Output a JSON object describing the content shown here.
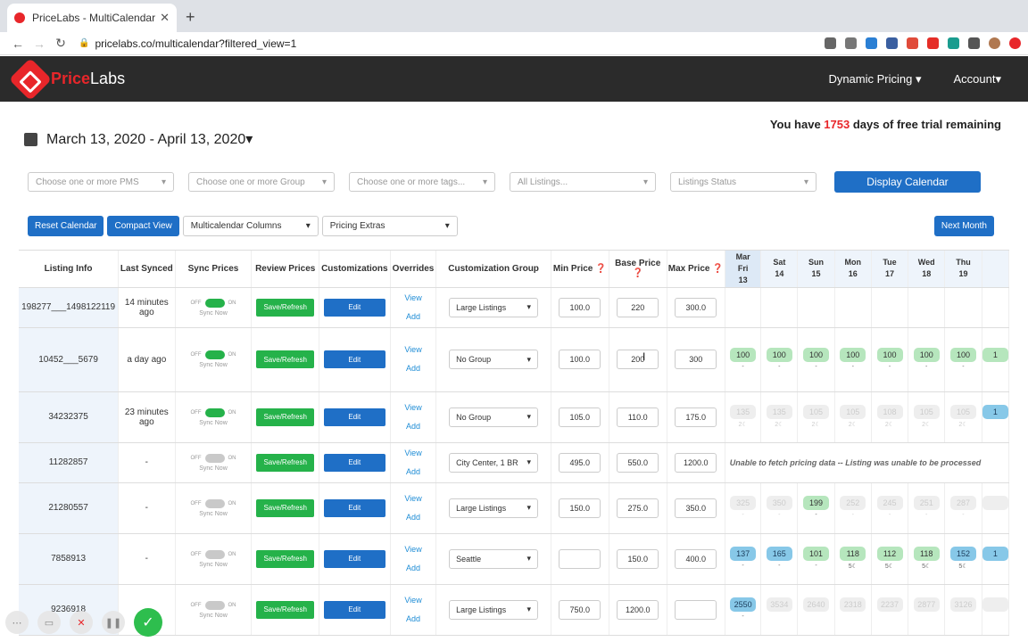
{
  "browser": {
    "tab_title": "PriceLabs - MultiCalendar",
    "tab_close": "✕",
    "new_tab": "+",
    "url": "pricelabs.co/multicalendar?filtered_view=1"
  },
  "app": {
    "logo_a": "Price",
    "logo_b": "Labs",
    "nav": [
      {
        "label": "Dynamic Pricing ▾"
      },
      {
        "label": "Account▾"
      }
    ]
  },
  "trial": {
    "pre": "You have ",
    "days": "1753",
    "post": " days of free trial remaining"
  },
  "date_range": "March 13, 2020 - April 13, 2020▾",
  "filters": {
    "pms": "Choose one or more PMS",
    "group": "Choose one or more Group",
    "tags": "Choose one or more tags...",
    "listings": "All Listings...",
    "status": "Listings Status",
    "display_btn": "Display Calendar"
  },
  "controls": {
    "reset": "Reset Calendar",
    "compact": "Compact View",
    "columns": "Multicalendar Columns",
    "extras": "Pricing Extras",
    "next_month": "Next Month"
  },
  "headers": {
    "listing": "Listing Info",
    "synced": "Last Synced",
    "sync": "Sync Prices",
    "review": "Review Prices",
    "custom": "Customizations",
    "overrides": "Overrides",
    "group": "Customization Group",
    "min": "Min Price ❓",
    "base": "Base Price ❓",
    "max": "Max Price ❓"
  },
  "days": [
    {
      "m": "Mar",
      "d": "Fri",
      "n": "13"
    },
    {
      "m": "",
      "d": "Sat",
      "n": "14"
    },
    {
      "m": "",
      "d": "Sun",
      "n": "15"
    },
    {
      "m": "",
      "d": "Mon",
      "n": "16"
    },
    {
      "m": "",
      "d": "Tue",
      "n": "17"
    },
    {
      "m": "",
      "d": "Wed",
      "n": "18"
    },
    {
      "m": "",
      "d": "Thu",
      "n": "19"
    },
    {
      "m": "",
      "d": "",
      "n": ""
    }
  ],
  "labels": {
    "sync_now": "Sync Now",
    "off": "OFF",
    "on": "ON",
    "save": "Save/Refresh",
    "edit": "Edit",
    "view": "View",
    "add": "Add",
    "caret": "▾"
  },
  "rows": [
    {
      "id": "198277___1498122119",
      "synced": "14 minutes ago",
      "sync_on": true,
      "group": "Large Listings",
      "min": "100.0",
      "base": "220",
      "max": "300.0",
      "cells": []
    },
    {
      "id": "10452___5679",
      "synced": "a day ago",
      "sync_on": true,
      "group": "No Group",
      "min": "100.0",
      "base": "200",
      "max": "300",
      "cells": [
        {
          "v": "100",
          "c": "green",
          "s": "-"
        },
        {
          "v": "100",
          "c": "green",
          "s": "-"
        },
        {
          "v": "100",
          "c": "green",
          "s": "-"
        },
        {
          "v": "100",
          "c": "green",
          "s": "-"
        },
        {
          "v": "100",
          "c": "green",
          "s": "-"
        },
        {
          "v": "100",
          "c": "green",
          "s": "-"
        },
        {
          "v": "100",
          "c": "green",
          "s": "-"
        },
        {
          "v": "1",
          "c": "green",
          "s": ""
        }
      ]
    },
    {
      "id": "34232375",
      "synced": "23 minutes ago",
      "sync_on": true,
      "group": "No Group",
      "min": "105.0",
      "base": "110.0",
      "max": "175.0",
      "cells": [
        {
          "v": "135",
          "c": "grey",
          "s": "2☾"
        },
        {
          "v": "135",
          "c": "grey",
          "s": "2☾"
        },
        {
          "v": "105",
          "c": "grey",
          "s": "2☾"
        },
        {
          "v": "105",
          "c": "grey",
          "s": "2☾"
        },
        {
          "v": "108",
          "c": "grey",
          "s": "2☾"
        },
        {
          "v": "105",
          "c": "grey",
          "s": "2☾"
        },
        {
          "v": "105",
          "c": "grey",
          "s": "2☾"
        },
        {
          "v": "1",
          "c": "blue",
          "s": ""
        }
      ]
    },
    {
      "id": "11282857",
      "synced": "-",
      "sync_on": false,
      "group": "City Center, 1 BR",
      "min": "495.0",
      "base": "550.0",
      "max": "1200.0",
      "error": "Unable to fetch pricing data   --   Listing was unable to be processed"
    },
    {
      "id": "21280557",
      "synced": "-",
      "sync_on": false,
      "group": "Large Listings",
      "min": "150.0",
      "base": "275.0",
      "max": "350.0",
      "cells": [
        {
          "v": "325",
          "c": "grey",
          "s": "-"
        },
        {
          "v": "350",
          "c": "grey",
          "s": "-"
        },
        {
          "v": "199",
          "c": "green",
          "s": "-"
        },
        {
          "v": "252",
          "c": "grey",
          "s": "-"
        },
        {
          "v": "245",
          "c": "grey",
          "s": "-"
        },
        {
          "v": "251",
          "c": "grey",
          "s": "-"
        },
        {
          "v": "287",
          "c": "grey",
          "s": "-"
        },
        {
          "v": "",
          "c": "grey",
          "s": ""
        }
      ]
    },
    {
      "id": "7858913",
      "synced": "-",
      "sync_on": false,
      "group": "Seattle",
      "min": "",
      "base": "150.0",
      "max": "400.0",
      "cells": [
        {
          "v": "137",
          "c": "blue",
          "s": "-"
        },
        {
          "v": "165",
          "c": "blue",
          "s": "-"
        },
        {
          "v": "101",
          "c": "green",
          "s": "-"
        },
        {
          "v": "118",
          "c": "green",
          "s": "5☾"
        },
        {
          "v": "112",
          "c": "green",
          "s": "5☾"
        },
        {
          "v": "118",
          "c": "green",
          "s": "5☾"
        },
        {
          "v": "152",
          "c": "blue",
          "s": "5☾"
        },
        {
          "v": "1",
          "c": "blue",
          "s": ""
        }
      ]
    },
    {
      "id": "9236918",
      "synced": "",
      "sync_on": false,
      "group": "Large Listings",
      "min": "750.0",
      "base": "1200.0",
      "max": "",
      "cells": [
        {
          "v": "2550",
          "c": "blue",
          "s": "-"
        },
        {
          "v": "3534",
          "c": "grey",
          "s": ""
        },
        {
          "v": "2640",
          "c": "grey",
          "s": ""
        },
        {
          "v": "2318",
          "c": "grey",
          "s": ""
        },
        {
          "v": "2237",
          "c": "grey",
          "s": ""
        },
        {
          "v": "2877",
          "c": "grey",
          "s": ""
        },
        {
          "v": "3126",
          "c": "grey",
          "s": ""
        },
        {
          "v": "",
          "c": "grey",
          "s": ""
        }
      ]
    }
  ],
  "recorder": {
    "more": "⋯",
    "cam": "▭",
    "close": "✕",
    "pause": "❚❚",
    "done": "✓"
  }
}
